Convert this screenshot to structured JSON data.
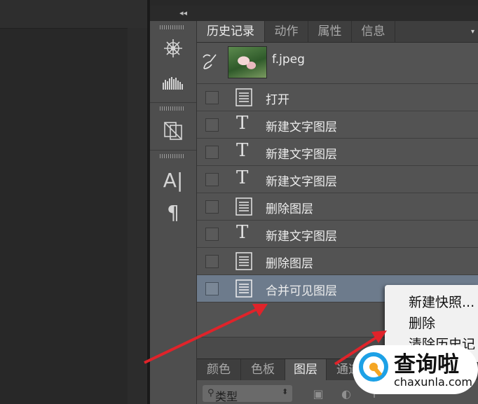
{
  "tabs": [
    "历史记录",
    "动作",
    "属性",
    "信息"
  ],
  "snapshot": {
    "name": "f.jpeg"
  },
  "history": [
    {
      "label": "打开",
      "icon": "document-icon"
    },
    {
      "label": "新建文字图层",
      "icon": "type-icon"
    },
    {
      "label": "新建文字图层",
      "icon": "type-icon"
    },
    {
      "label": "新建文字图层",
      "icon": "type-icon"
    },
    {
      "label": "删除图层",
      "icon": "document-icon"
    },
    {
      "label": "新建文字图层",
      "icon": "type-icon"
    },
    {
      "label": "删除图层",
      "icon": "document-icon"
    },
    {
      "label": "合并可见图层",
      "icon": "document-icon",
      "selected": true
    }
  ],
  "tools": {
    "character_glyph": "A|",
    "paragraph_glyph": "¶"
  },
  "context_menu": [
    "新建快照...",
    "删除",
    "清除历史记"
  ],
  "layers_tabs": [
    "颜色",
    "色板",
    "图层",
    "通道"
  ],
  "layers_filter": {
    "label": "类型"
  },
  "watermark": {
    "name": "查询啦",
    "url": "chaxunla.com"
  },
  "colors": {
    "selected_row": "#6d7b8c",
    "panel_bg": "#535353",
    "arrow": "#e0232a",
    "watermark_accent": "#1da1e6"
  }
}
